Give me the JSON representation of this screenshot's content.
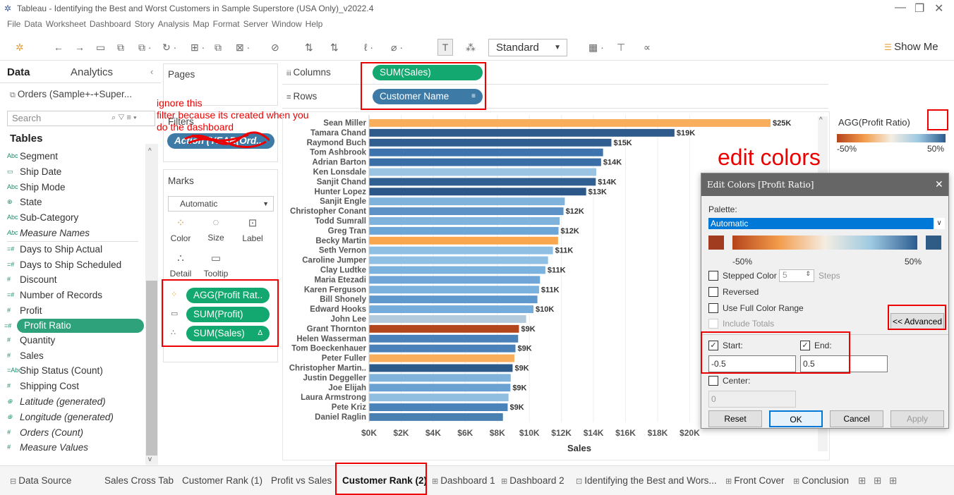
{
  "window": {
    "title": "Tableau - Identifying the Best and Worst Customers in Sample Superstore (USA Only)_v2022.4",
    "minimize": "—",
    "restore": "❐",
    "close": "✕"
  },
  "menu": [
    "File",
    "Data",
    "Worksheet",
    "Dashboard",
    "Story",
    "Analysis",
    "Map",
    "Format",
    "Server",
    "Window",
    "Help"
  ],
  "toolbar": {
    "fit": "Standard",
    "show_me": "Show Me"
  },
  "left_pane": {
    "tab_data": "Data",
    "tab_analytics": "Analytics",
    "datasource": "Orders (Sample+-+Super...",
    "search_placeholder": "Search",
    "tables_heading": "Tables",
    "fields": [
      {
        "icon": "Abc",
        "name": "Segment"
      },
      {
        "icon": "▭",
        "name": "Ship Date"
      },
      {
        "icon": "Abc",
        "name": "Ship Mode"
      },
      {
        "icon": "⊕",
        "name": "State"
      },
      {
        "icon": "Abc",
        "name": "Sub-Category"
      },
      {
        "icon": "Abc",
        "name": "Measure Names",
        "italic": true
      },
      {
        "icon": "=#",
        "name": "Days to Ship Actual"
      },
      {
        "icon": "=#",
        "name": "Days to Ship Scheduled"
      },
      {
        "icon": "#",
        "name": "Discount"
      },
      {
        "icon": "=#",
        "name": "Number of Records"
      },
      {
        "icon": "#",
        "name": "Profit"
      },
      {
        "icon": "=#",
        "name": "Profit Ratio",
        "selected": true
      },
      {
        "icon": "#",
        "name": "Quantity"
      },
      {
        "icon": "#",
        "name": "Sales"
      },
      {
        "icon": "=Abc",
        "name": "Ship Status (Count)"
      },
      {
        "icon": "#",
        "name": "Shipping Cost"
      },
      {
        "icon": "⊕",
        "name": "Latitude (generated)",
        "italic": true
      },
      {
        "icon": "⊕",
        "name": "Longitude (generated)",
        "italic": true
      },
      {
        "icon": "#",
        "name": "Orders (Count)",
        "italic": true
      },
      {
        "icon": "#",
        "name": "Measure Values",
        "italic": true
      }
    ]
  },
  "cards": {
    "pages": "Pages",
    "filters": "Filters",
    "filter_pill": "Action (YEAR(Ord...",
    "marks": "Marks",
    "mark_type": "Automatic",
    "color": "Color",
    "size": "Size",
    "label": "Label",
    "detail": "Detail",
    "tooltip": "Tooltip",
    "mark_fields": [
      "AGG(Profit Rat..",
      "SUM(Profit)",
      "SUM(Sales)"
    ]
  },
  "shelves": {
    "columns_label": "Columns",
    "rows_label": "Rows",
    "columns_pill": "SUM(Sales)",
    "rows_pill": "Customer Name"
  },
  "annotations": {
    "note1": "ignore this",
    "note2": "filter because its created when you",
    "note3": "do the dashboard",
    "edit": "edit colors"
  },
  "legend": {
    "title": "AGG(Profit Ratio)",
    "min": "-50%",
    "max": "50%"
  },
  "dialog": {
    "title": "Edit Colors [Profit Ratio]",
    "palette_label": "Palette:",
    "palette_value": "Automatic",
    "min": "-50%",
    "max": "50%",
    "stepped": "Stepped Color",
    "steps_value": "5",
    "steps": "Steps",
    "reversed": "Reversed",
    "full_range": "Use Full Color Range",
    "include_totals": "Include Totals",
    "advanced": "<< Advanced",
    "start": "Start:",
    "end": "End:",
    "start_value": "-0.5",
    "end_value": "0.5",
    "center": "Center:",
    "center_value": "0",
    "reset": "Reset",
    "ok": "OK",
    "cancel": "Cancel",
    "apply": "Apply"
  },
  "sheet_tabs": [
    "Data Source",
    "Sales Cross Tab",
    "Customer Rank (1)",
    "Profit vs Sales",
    "Customer Rank (2)",
    "Dashboard 1",
    "Dashboard 2",
    "Identifying the Best and Wors...",
    "Front Cover",
    "Conclusion"
  ],
  "chart_data": {
    "type": "bar",
    "orientation": "horizontal",
    "xlabel": "Sales",
    "x_ticks": [
      "$0K",
      "$2K",
      "$4K",
      "$6K",
      "$8K",
      "$10K",
      "$12K",
      "$14K",
      "$16K",
      "$18K",
      "$20K"
    ],
    "categories": [
      "Sean Miller",
      "Tamara Chand",
      "Raymond Buch",
      "Tom Ashbrook",
      "Adrian Barton",
      "Ken Lonsdale",
      "Sanjit Chand",
      "Hunter Lopez",
      "Sanjit Engle",
      "Christopher Conant",
      "Todd Sumrall",
      "Greg Tran",
      "Becky Martin",
      "Seth Vernon",
      "Caroline Jumper",
      "Clay Ludtke",
      "Maria Etezadi",
      "Karen Ferguson",
      "Bill Shonely",
      "Edward Hooks",
      "John Lee",
      "Grant Thornton",
      "Helen Wasserman",
      "Tom Boeckenhauer",
      "Peter Fuller",
      "Christopher Martin..",
      "Justin Deggeller",
      "Joe Elijah",
      "Laura Armstrong",
      "Pete Kriz",
      "Daniel Raglin"
    ],
    "values": [
      25043,
      19052,
      15117,
      14596,
      14474,
      14175,
      14142,
      13542,
      12210,
      12129,
      11892,
      11820,
      11790,
      11471,
      11165,
      11000,
      10664,
      10604,
      10502,
      10255,
      9799,
      9351,
      9300,
      9133,
      9063,
      8955,
      8836,
      8817,
      8700,
      8647,
      8351
    ],
    "labels": [
      "$25K",
      "$19K",
      "$15K",
      "",
      "$14K",
      "",
      "$14K",
      "$13K",
      "",
      "$12K",
      "",
      "$12K",
      "",
      "$11K",
      "",
      "$11K",
      "",
      "$11K",
      "",
      "$10K",
      "",
      "$9K",
      "",
      "$9K",
      "",
      "$9K",
      "",
      "$9K",
      "",
      "$9K",
      ""
    ],
    "colors": [
      "#f9ae5b",
      "#2e5b8c",
      "#305e91",
      "#3d74ad",
      "#3a6ea6",
      "#9ac4e2",
      "#305f92",
      "#2b5888",
      "#7fb3db",
      "#5c92c6",
      "#7fb3db",
      "#6ca6d6",
      "#f9a64e",
      "#8fc0e4",
      "#8fbfe3",
      "#7cb2de",
      "#6fa6d7",
      "#7ab1dd",
      "#5f98cc",
      "#74acdb",
      "#b3cadd",
      "#b2461c",
      "#4a81b9",
      "#4a81b8",
      "#f9ae5b",
      "#2c5a8b",
      "#7fb3db",
      "#6aa1d3",
      "#90bee1",
      "#4a82ba",
      "#4a7fb2"
    ]
  }
}
